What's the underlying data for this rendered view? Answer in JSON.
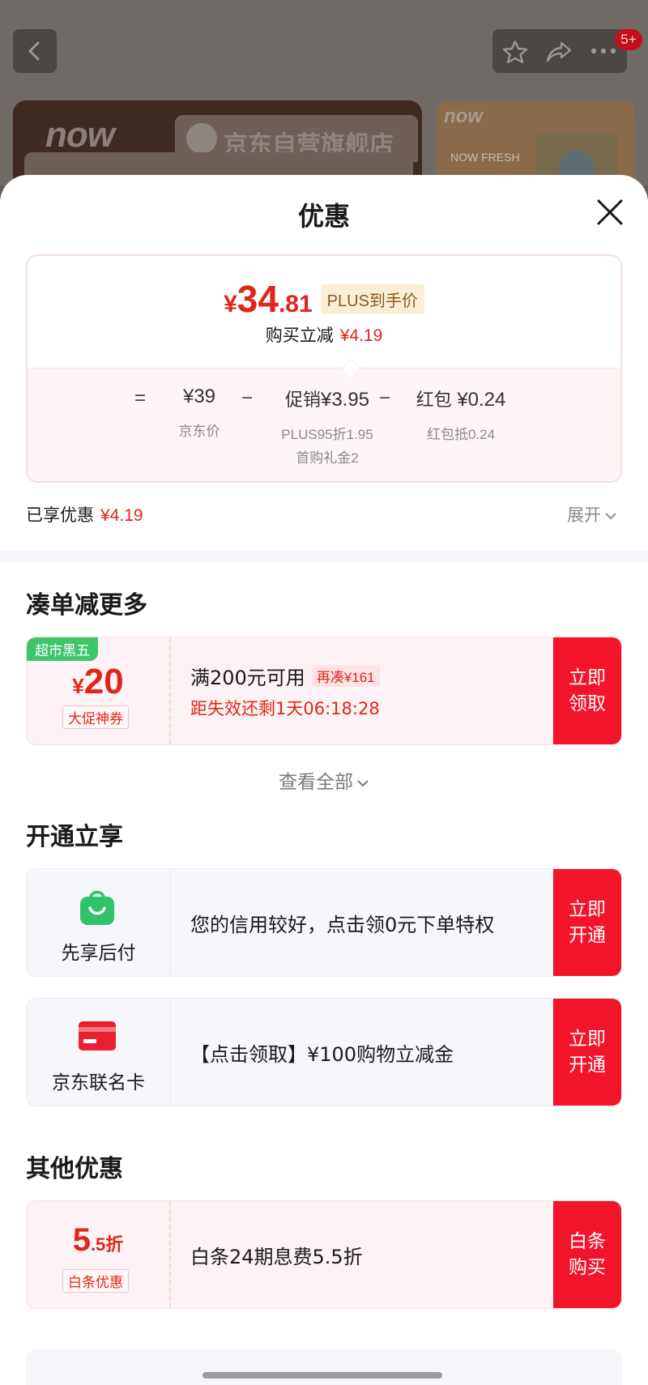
{
  "background": {
    "badge": "5+",
    "now_logo": "now",
    "store_name": "京东自营旗舰店",
    "now_logo2": "now",
    "fresh_text": "NOW FRESH"
  },
  "sheet": {
    "title": "优惠"
  },
  "price_card": {
    "currency": "¥",
    "price_int": "34",
    "price_dec": ".81",
    "plus_tag": "PLUS到手价",
    "reduce_label": "购买立减",
    "reduce_amount": "¥4.19",
    "calc": {
      "eq": "=",
      "jd_price": "¥39",
      "jd_price_label": "京东价",
      "minus1": "−",
      "promo_label": "促销",
      "promo_value": "¥3.95",
      "promo_sub1": "PLUS95折1.95",
      "promo_sub2": "首购礼金2",
      "minus2": "−",
      "redpack_label": "红包",
      "redpack_value": "¥0.24",
      "redpack_sub": "红包抵0.24"
    }
  },
  "enjoyed": {
    "label": "已享优惠",
    "amount": "¥4.19",
    "expand": "展开"
  },
  "section_more": {
    "title": "凑单减更多",
    "coupon": {
      "tag": "超市黑五",
      "currency": "¥",
      "amount": "20",
      "sub": "大促神券",
      "condition": "满200元可用",
      "more_tag": "再凑¥161",
      "expire": "距失效还剩1天06:18:28",
      "btn_line1": "立即",
      "btn_line2": "领取"
    },
    "see_all": "查看全部"
  },
  "section_open": {
    "title": "开通立享",
    "items": [
      {
        "label": "先享后付",
        "text": "您的信用较好，点击领0元下单特权",
        "btn_line1": "立即",
        "btn_line2": "开通"
      },
      {
        "label": "京东联名卡",
        "text": "【点击领取】¥100购物立减金",
        "btn_line1": "立即",
        "btn_line2": "开通"
      }
    ]
  },
  "section_other": {
    "title": "其他优惠",
    "discount": {
      "big": "5",
      "small": ".5折",
      "sub": "白条优惠",
      "text": "白条24期息费5.5折",
      "btn_line1": "白条",
      "btn_line2": "购买"
    }
  },
  "colors": {
    "accent_red": "#e1251b",
    "button_red": "#f2142a",
    "green": "#3fc66b"
  },
  "icons": {
    "back": "chevron-left-icon",
    "favorite": "star-icon",
    "share": "share-icon",
    "more": "more-dots-icon",
    "close": "close-icon",
    "expand": "chevron-down-icon",
    "pay_later": "shopping-bag-icon",
    "card": "credit-card-icon"
  }
}
